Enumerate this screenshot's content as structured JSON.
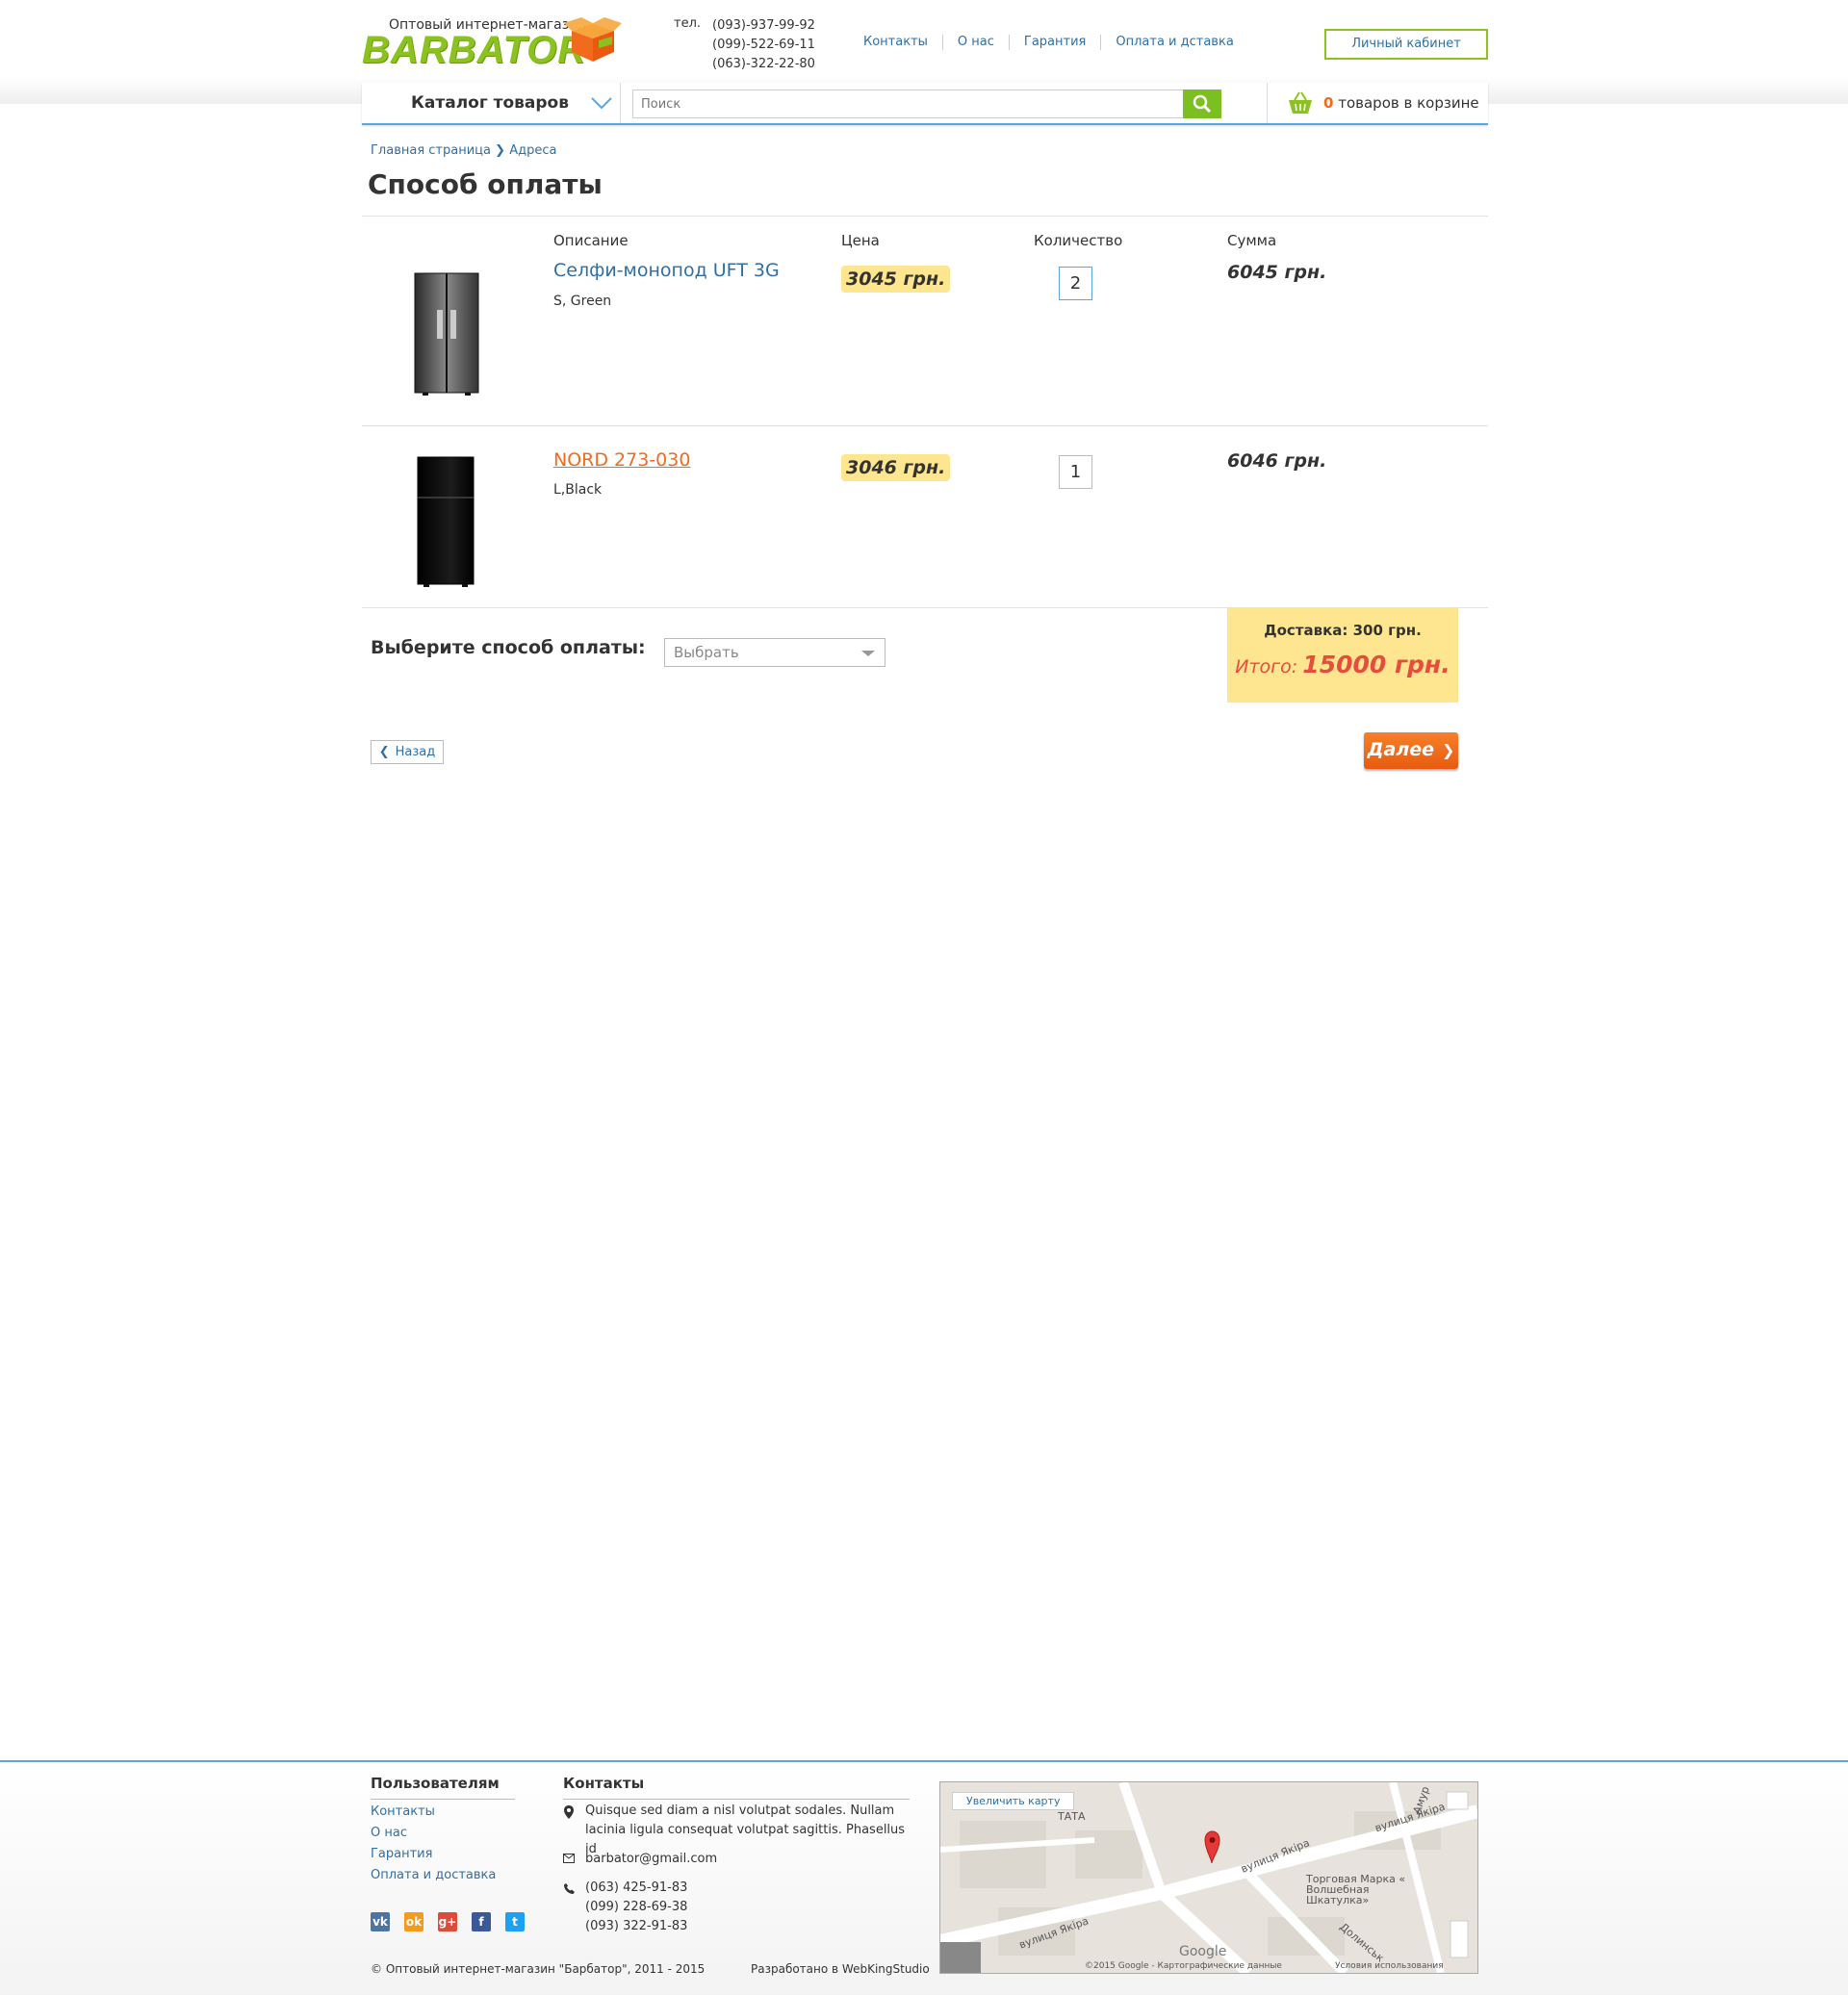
{
  "header": {
    "logo_tagline": "Оптовый интернет-магазин",
    "logo_word": "BARBATOR",
    "phone_label": "тел.",
    "phones": [
      "(093)-937-99-92",
      "(099)-522-69-11",
      "(063)-322-22-80"
    ],
    "nav": [
      "Контакты",
      "О нас",
      "Гарантия",
      "Оплата и дставка"
    ],
    "cabinet_label": "Личный кабинет",
    "brand_color": "#8cc21f",
    "accent_color": "#f26b1d"
  },
  "navbar": {
    "catalog_label": "Каталог товаров",
    "search_placeholder": "Поиск",
    "cart_count": "0",
    "cart_text": "товаров в корзине"
  },
  "breadcrumb": {
    "home": "Главная страница",
    "sep": "❯",
    "current": "Адреса"
  },
  "page_title": "Способ оплаты",
  "columns": {
    "description": "Описание",
    "price": "Цена",
    "quantity": "Количество",
    "sum": "Сумма"
  },
  "items": [
    {
      "title": "Селфи-монопод UFT 3G",
      "options": "S, Green",
      "price": "3045 грн.",
      "quantity": "2",
      "sum": "6045 грн."
    },
    {
      "title": "NORD 273-030",
      "options": "L,Black",
      "price": "3046 грн.",
      "quantity": "1",
      "sum": "6046 грн."
    }
  ],
  "payment": {
    "label": "Выберите способ оплаты:",
    "selected": "Выбрать"
  },
  "totals": {
    "delivery": "Доставка: 300 грн.",
    "total_label": "Итого:",
    "total_value": "15000 грн."
  },
  "buttons": {
    "back": "Назад",
    "next": "Далее"
  },
  "footer": {
    "users_heading": "Пользователям",
    "users_links": [
      "Контакты",
      "О нас",
      "Гарантия",
      "Оплата и доставка"
    ],
    "contacts_heading": "Контакты",
    "address": "Quisque sed diam a nisl volutpat sodales. Nullam lacinia ligula consequat volutpat sagittis. Phasellus id",
    "email": "barbator@gmail.com",
    "phones": [
      "(063) 425-91-83",
      "(099) 228-69-38",
      "(093) 322-91-83"
    ],
    "social": [
      "vk-icon",
      "odnoklassniki-icon",
      "google-plus-icon",
      "facebook-icon",
      "twitter-icon"
    ],
    "copyright": "© Оптовый интернет-магазин \"Барбатор\", 2011 - 2015",
    "developer": "Разработано в WebKingStudio",
    "map": {
      "zoom_label": "Увеличить карту",
      "labels": [
        "вулиця Якіра",
        "вулиця Якіра",
        "вулиця Якіра",
        "Торговая Марка « Волшебная Шкатулка»",
        "ТАТА",
        "Google",
        "©2015 Google - Картографические данные",
        "Условия использования",
        "Долинськ",
        "Амур"
      ]
    }
  }
}
